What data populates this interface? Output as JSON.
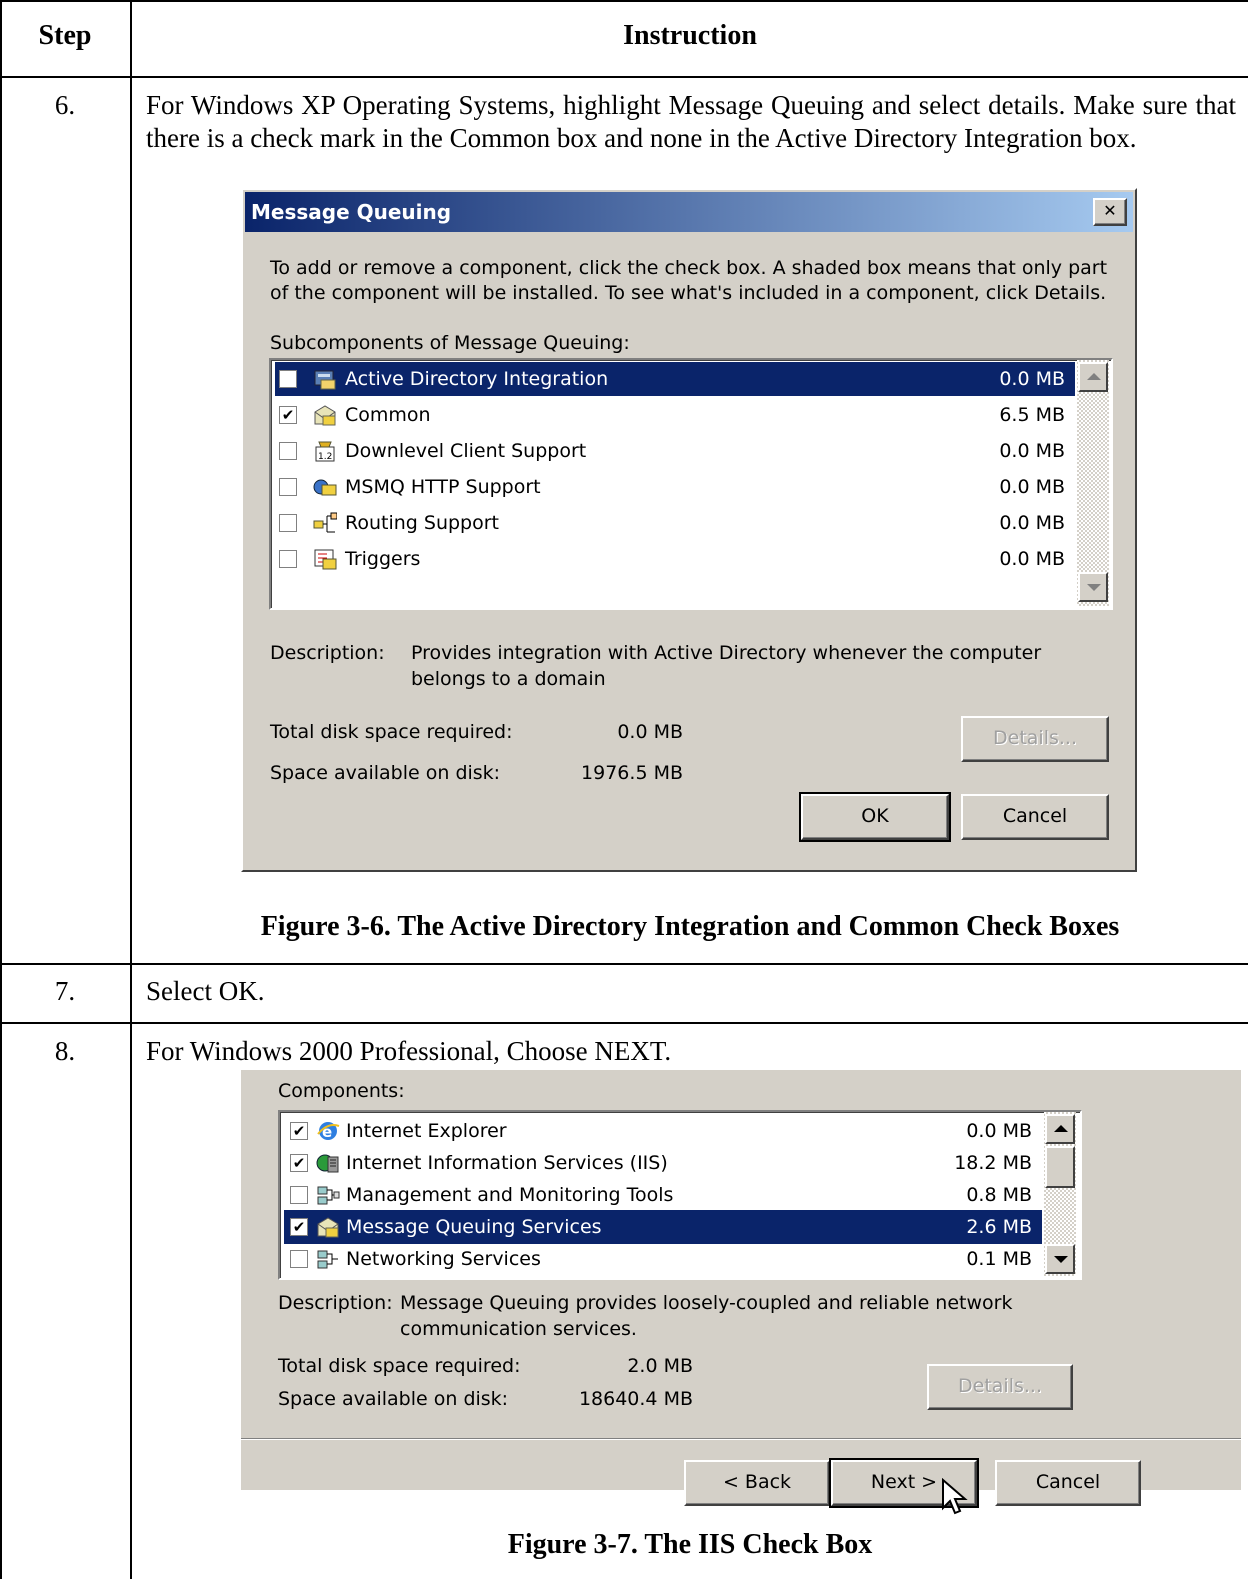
{
  "table": {
    "header_step": "Step",
    "header_instruction": "Instruction"
  },
  "steps": [
    {
      "number": "6.",
      "text": "For Windows XP Operating Systems, highlight Message Queuing and select details. Make sure that there is a check mark in the Common box and none in the Active Directory Integration box.",
      "caption": "Figure 3-6.  The Active Directory Integration and Common Check Boxes"
    },
    {
      "number": "7.",
      "text": "Select OK."
    },
    {
      "number": "8.",
      "text": "For Windows 2000 Professional, Choose NEXT.",
      "caption": "Figure 3-7.  The IIS Check Box"
    }
  ],
  "dialog1": {
    "title": "Message Queuing",
    "close_glyph": "✕",
    "intro_line1": "To add or remove a component, click the check box. A shaded box means that only part",
    "intro_line2": "of the component will be installed. To see what's included in a component, click Details.",
    "list_label": "Subcomponents of Message Queuing:",
    "items": [
      {
        "label": "Active Directory Integration",
        "size": "0.0 MB",
        "checked": false,
        "selected": true,
        "icon": "directory-icon"
      },
      {
        "label": "Common",
        "size": "6.5 MB",
        "checked": true,
        "selected": false,
        "icon": "envelope-icon"
      },
      {
        "label": "Downlevel Client Support",
        "size": "0.0 MB",
        "checked": false,
        "selected": false,
        "icon": "downlevel-icon"
      },
      {
        "label": "MSMQ HTTP Support",
        "size": "0.0 MB",
        "checked": false,
        "selected": false,
        "icon": "http-envelope-icon"
      },
      {
        "label": "Routing Support",
        "size": "0.0 MB",
        "checked": false,
        "selected": false,
        "icon": "routing-icon"
      },
      {
        "label": "Triggers",
        "size": "0.0 MB",
        "checked": false,
        "selected": false,
        "icon": "triggers-icon"
      }
    ],
    "description_label": "Description:",
    "description_line1": "Provides integration with Active Directory whenever the computer",
    "description_line2": "belongs to a domain",
    "total_label": "Total disk space required:",
    "total_value": "0.0 MB",
    "available_label": "Space available on disk:",
    "available_value": "1976.5 MB",
    "details_button": "Details...",
    "ok_button": "OK",
    "cancel_button": "Cancel"
  },
  "dialog2": {
    "list_label": "Components:",
    "items": [
      {
        "label": "Internet Explorer",
        "size": "0.0 MB",
        "checked": true,
        "selected": false,
        "icon": "internet-explorer-icon"
      },
      {
        "label": "Internet Information Services (IIS)",
        "size": "18.2 MB",
        "checked": true,
        "selected": false,
        "icon": "iis-icon"
      },
      {
        "label": "Management and Monitoring Tools",
        "size": "0.8 MB",
        "checked": false,
        "selected": false,
        "icon": "tools-icon"
      },
      {
        "label": "Message Queuing Services",
        "size": "2.6 MB",
        "checked": true,
        "selected": true,
        "icon": "envelope-icon"
      },
      {
        "label": "Networking Services",
        "size": "0.1 MB",
        "checked": false,
        "selected": false,
        "icon": "network-icon"
      }
    ],
    "description_label": "Description:",
    "description_line1": "Message Queuing provides loosely-coupled and reliable network",
    "description_line2": "communication services.",
    "total_label": "Total disk space required:",
    "total_value": "2.0 MB",
    "available_label": "Space available on disk:",
    "available_value": "18640.4 MB",
    "details_button": "Details...",
    "back_button": "< Back",
    "next_button": "Next >",
    "cancel_button": "Cancel"
  }
}
